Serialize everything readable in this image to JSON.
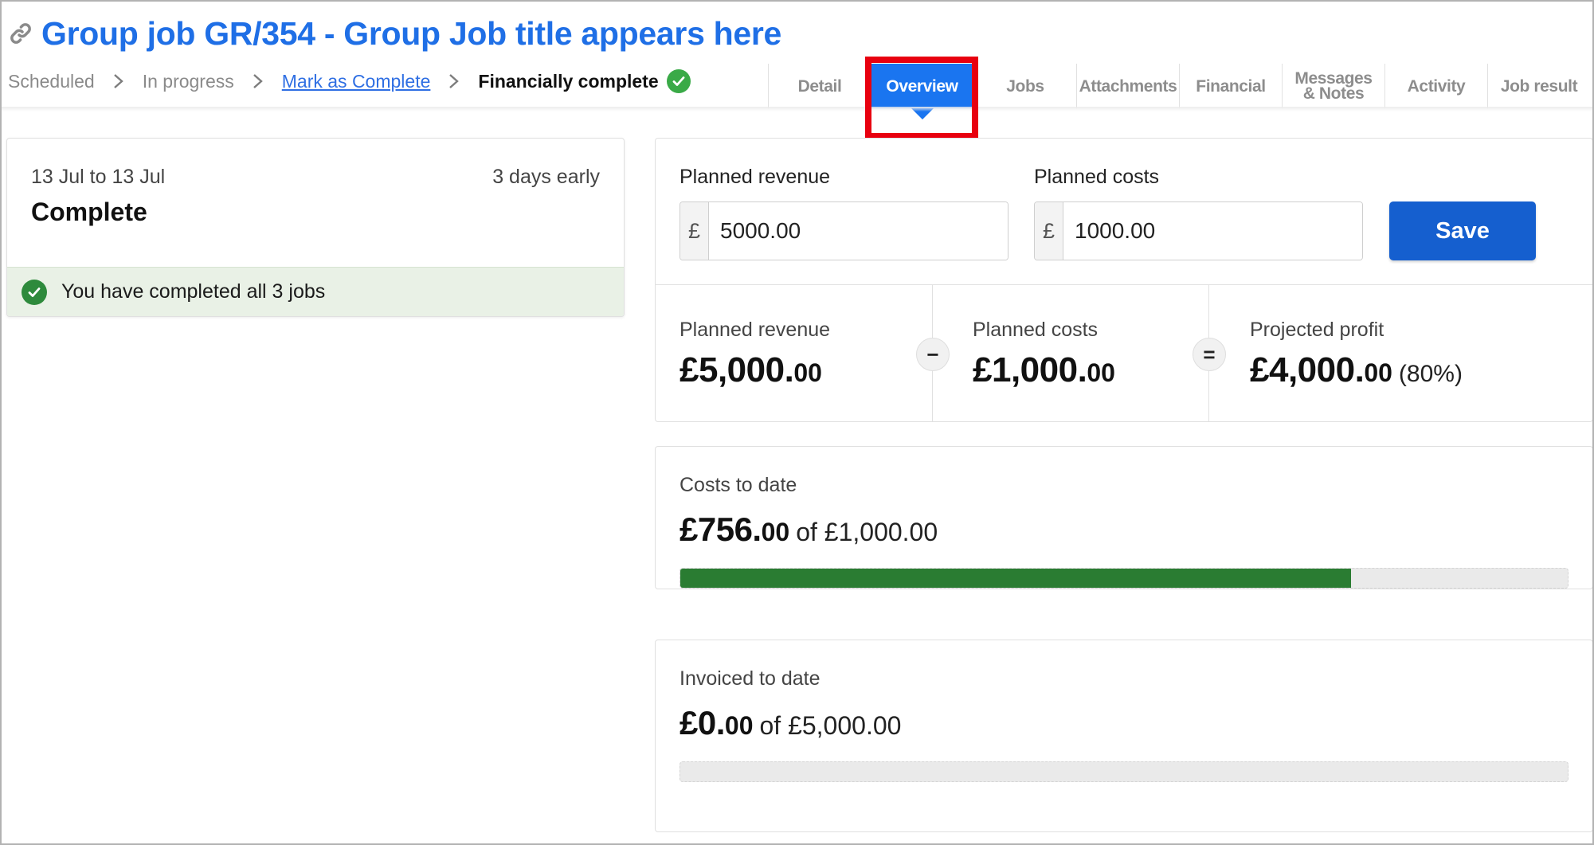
{
  "header": {
    "title": "Group job GR/354 - Group Job title appears here",
    "steps": [
      {
        "label": "Scheduled",
        "state": "done"
      },
      {
        "label": "In progress",
        "state": "done"
      },
      {
        "label": "Mark as Complete",
        "state": "link"
      },
      {
        "label": "Financially complete",
        "state": "current"
      }
    ]
  },
  "tabs": [
    {
      "label": "Detail",
      "active": false
    },
    {
      "label": "Overview",
      "active": true
    },
    {
      "label": "Jobs",
      "active": false
    },
    {
      "label": "Attachments",
      "active": false
    },
    {
      "label": "Financial",
      "active": false
    },
    {
      "label": "Messages & Notes",
      "active": false
    },
    {
      "label": "Activity",
      "active": false
    },
    {
      "label": "Job result",
      "active": false
    }
  ],
  "summary_card": {
    "dates": "13 Jul to 13 Jul",
    "timing": "3 days early",
    "status": "Complete",
    "banner": "You have completed all 3 jobs"
  },
  "financials": {
    "revenue_label": "Planned revenue",
    "costs_label": "Planned costs",
    "currency_symbol": "£",
    "revenue_value": "5000.00",
    "costs_value": "1000.00",
    "save_label": "Save",
    "summary": {
      "revenue_label": "Planned revenue",
      "revenue_major": "£5,000.",
      "revenue_minor": "00",
      "minus_symbol": "−",
      "costs_label": "Planned costs",
      "costs_major": "£1,000.",
      "costs_minor": "00",
      "equals_symbol": "=",
      "profit_label": "Projected profit",
      "profit_major": "£4,000.",
      "profit_minor": "00",
      "profit_pct": "(80%)"
    }
  },
  "costs_to_date": {
    "label": "Costs to date",
    "major": "£756.",
    "minor": "00",
    "of_text": "of £1,000.00",
    "progress_fraction": 0.756
  },
  "invoiced_to_date": {
    "label": "Invoiced to date",
    "major": "£0.",
    "minor": "00",
    "of_text": "of £5,000.00",
    "progress_fraction": 0.0
  },
  "colors": {
    "accent": "#1a75f0",
    "title": "#1f6fe6",
    "success": "#3aaa47",
    "progress": "#2a7c32",
    "highlight": "#e8000f",
    "save_button": "#155fcf"
  },
  "icons": {
    "title_icon": "link-icon",
    "step_separator": "chevron-right-icon",
    "step_complete": "check-circle-icon"
  }
}
